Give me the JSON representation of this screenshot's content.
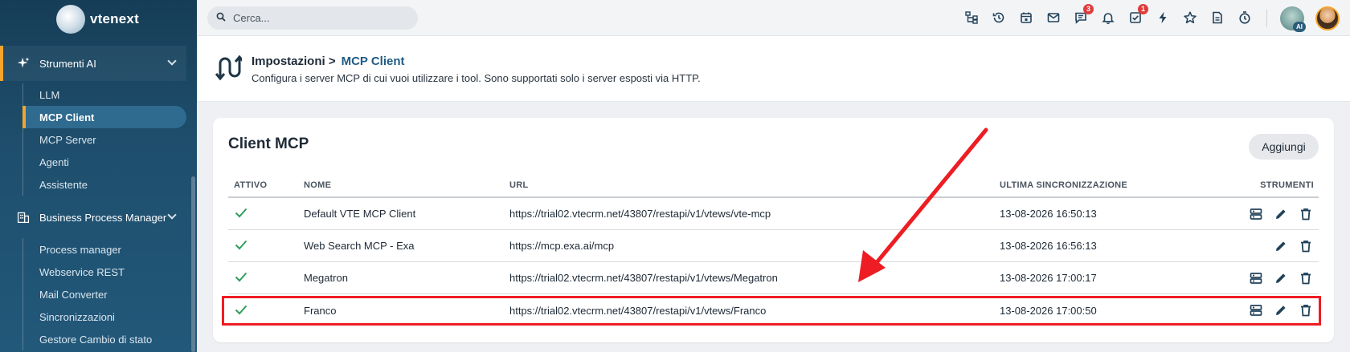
{
  "app": {
    "logo_text": "vtenext"
  },
  "topbar": {
    "search_placeholder": "Cerca...",
    "icons": [
      {
        "name": "sitemap-icon"
      },
      {
        "name": "history-icon"
      },
      {
        "name": "calendar-icon"
      },
      {
        "name": "mail-icon"
      },
      {
        "name": "chat-icon",
        "badge": "3"
      },
      {
        "name": "bell-icon"
      },
      {
        "name": "todo-check-icon",
        "badge": "1"
      },
      {
        "name": "bolt-icon"
      },
      {
        "name": "star-icon"
      },
      {
        "name": "document-icon"
      },
      {
        "name": "timer-icon"
      }
    ],
    "ai_tag": "AI"
  },
  "sidebar": {
    "section_ai": {
      "label": "Strumenti AI"
    },
    "ai_items": [
      {
        "label": "LLM",
        "active": false
      },
      {
        "label": "MCP Client",
        "active": true
      },
      {
        "label": "MCP Server",
        "active": false
      },
      {
        "label": "Agenti",
        "active": false
      },
      {
        "label": "Assistente",
        "active": false
      }
    ],
    "section_bpm": {
      "label": "Business Process Manager"
    },
    "bpm_items": [
      {
        "label": "Process manager"
      },
      {
        "label": "Webservice REST"
      },
      {
        "label": "Mail Converter"
      },
      {
        "label": "Sincronizzazioni"
      },
      {
        "label": "Gestore Cambio di stato"
      }
    ]
  },
  "header": {
    "breadcrumb_root": "Impostazioni >",
    "breadcrumb_current": "MCP Client",
    "description": "Configura i server MCP di cui vuoi utilizzare i tool. Sono supportati solo i server esposti via HTTP."
  },
  "card": {
    "title": "Client MCP",
    "add_label": "Aggiungi",
    "columns": {
      "active": "ATTIVO",
      "name": "NOME",
      "url": "URL",
      "last_sync": "ULTIMA SINCRONIZZAZIONE",
      "tools": "STRUMENTI"
    },
    "rows": [
      {
        "name": "Default VTE MCP Client",
        "url": "https://trial02.vtecrm.net/43807/restapi/v1/vtews/vte-mcp",
        "last_sync": "13-08-2026 16:50:13"
      },
      {
        "name": "Web Search MCP - Exa",
        "url": "https://mcp.exa.ai/mcp",
        "last_sync": "13-08-2026 16:56:13"
      },
      {
        "name": "Megatron",
        "url": "https://trial02.vtecrm.net/43807/restapi/v1/vtews/Megatron",
        "last_sync": "13-08-2026 17:00:17"
      },
      {
        "name": "Franco",
        "url": "https://trial02.vtecrm.net/43807/restapi/v1/vtews/Franco",
        "last_sync": "13-08-2026 17:00:50"
      }
    ]
  },
  "colors": {
    "accent": "#f3a52c",
    "check": "#2e9e5b",
    "annotation": "#ee1d23",
    "primary_text": "#1f5b84"
  }
}
